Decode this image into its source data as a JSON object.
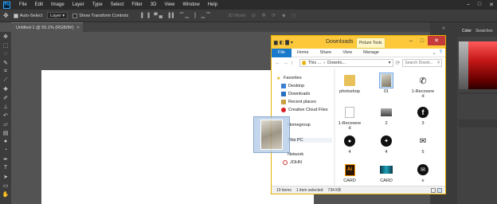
{
  "app": {
    "menu": [
      "File",
      "Edit",
      "Image",
      "Layer",
      "Type",
      "Select",
      "Filter",
      "3D",
      "View",
      "Window",
      "Help"
    ],
    "logo": "Ps"
  },
  "options": {
    "auto_select_label": "Auto-Select",
    "layer_select": "Layer",
    "show_transform_label": "Show Transform Controls",
    "mode_3d": "3D Mode:"
  },
  "document": {
    "tab_title": "Untitled-1 @ 55.1% (RGB/8#)",
    "tab_close": "×"
  },
  "right_panel": {
    "tabs": [
      "Color",
      "Swatches"
    ]
  },
  "explorer": {
    "title": "Downloads",
    "context_tab": "Picture Tools",
    "ribbon_tabs": [
      "File",
      "Home",
      "Share",
      "View",
      "Manage"
    ],
    "path_parts": [
      "This ...",
      "Downlo..."
    ],
    "search_placeholder": "Search Downl...",
    "nav_items": [
      {
        "label": "Favorites",
        "icon": "star-icon"
      },
      {
        "label": "Desktop",
        "icon": "desktop-icon"
      },
      {
        "label": "Downloads",
        "icon": "downloads-icon"
      },
      {
        "label": "Recent places",
        "icon": "recent-icon"
      },
      {
        "label": "Creative Cloud Files",
        "icon": "creative-cloud-icon"
      },
      {
        "label": "Homegroup",
        "icon": "homegroup-icon"
      },
      {
        "label": "This PC",
        "icon": "computer-icon"
      },
      {
        "label": "Network",
        "icon": "network-icon"
      },
      {
        "label": "JOHN",
        "icon": "computer-icon"
      }
    ],
    "files": [
      {
        "label": "photoshop",
        "icon": "folder-icon"
      },
      {
        "label": "01",
        "icon": "photo-thumbnail"
      },
      {
        "label": "1-Recovere d",
        "icon": "phone-icon"
      },
      {
        "label": "1-Recovere d",
        "icon": "blank-file-icon"
      },
      {
        "label": "2",
        "icon": "gradient-thumbnail"
      },
      {
        "label": "3",
        "icon": "facebook-icon"
      },
      {
        "label": "4",
        "icon": "map-pin-icon"
      },
      {
        "label": "4",
        "icon": "twitter-icon"
      },
      {
        "label": "5",
        "icon": "mail-icon"
      },
      {
        "label": "CARD",
        "icon": "illustrator-file-icon"
      },
      {
        "label": "CARD",
        "icon": "card-thumbnail"
      },
      {
        "label": "e",
        "icon": "email-circle-icon"
      }
    ],
    "status": {
      "items": "19 items",
      "selected": "1 item selected",
      "size": "734 KB"
    }
  },
  "colors": {
    "titlebar": "#fdc93a",
    "file_tab": "#1979ca",
    "ps_blue": "#31a8ff"
  }
}
